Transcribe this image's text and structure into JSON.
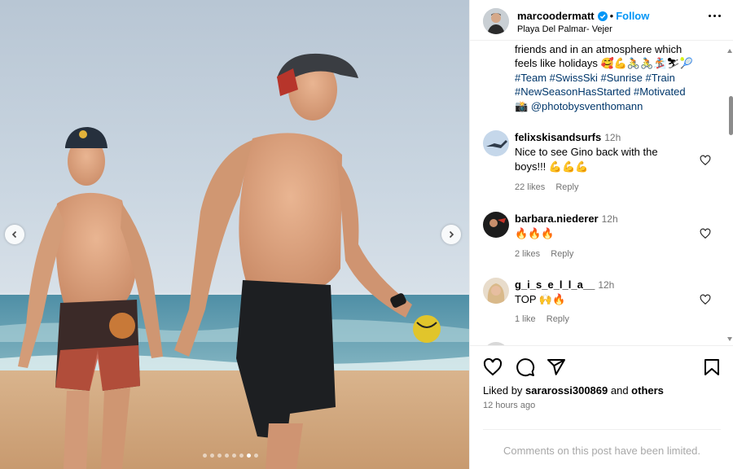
{
  "post": {
    "username": "marcoodermatt",
    "follow_label": "Follow",
    "separator": "•",
    "location": "Playa Del Palmar- Vejer",
    "carousel": {
      "slide_count": 8,
      "active_slide": 7
    }
  },
  "caption": {
    "line1": "friends and in an atmosphere which",
    "line2": "feels like holidays 🥰💪🚴🚴🏂⛷🎾",
    "tags_line1": [
      "#Team",
      "#SwissSki",
      "#Sunrise",
      "#Train"
    ],
    "tags_line2": [
      "#NewSeasonHasStarted",
      "#Motivated"
    ],
    "photo_credit_icon": "📸",
    "photo_credit": "@photobysventhomann"
  },
  "comments": [
    {
      "username": "felixskisandsurfs",
      "time": "12h",
      "text": "Nice to see Gino back with the boys!!! 💪💪💪",
      "likes": "22 likes",
      "reply": "Reply"
    },
    {
      "username": "barbara.niederer",
      "time": "12h",
      "text": "🔥🔥🔥",
      "likes": "2 likes",
      "reply": "Reply"
    },
    {
      "username": "g_i_s_e_l_l_a__",
      "time": "12h",
      "text": "TOP 🙌🔥",
      "likes": "1 like",
      "reply": "Reply"
    }
  ],
  "footer": {
    "liked_by_prefix": "Liked by ",
    "liked_by_user": "sararossi300869",
    "liked_by_mid": " and ",
    "liked_by_others": "others",
    "timestamp": "12 hours ago",
    "comments_limited": "Comments on this post have been limited."
  },
  "icons": {
    "verified": "verified-badge-icon",
    "more": "more-options-icon",
    "like": "heart-icon",
    "comment": "comment-icon",
    "share": "share-icon",
    "save": "bookmark-icon",
    "prev": "chevron-left-icon",
    "next": "chevron-right-icon"
  },
  "colors": {
    "link_blue": "#0095f6",
    "hashtag": "#00376b",
    "muted": "#737373"
  }
}
